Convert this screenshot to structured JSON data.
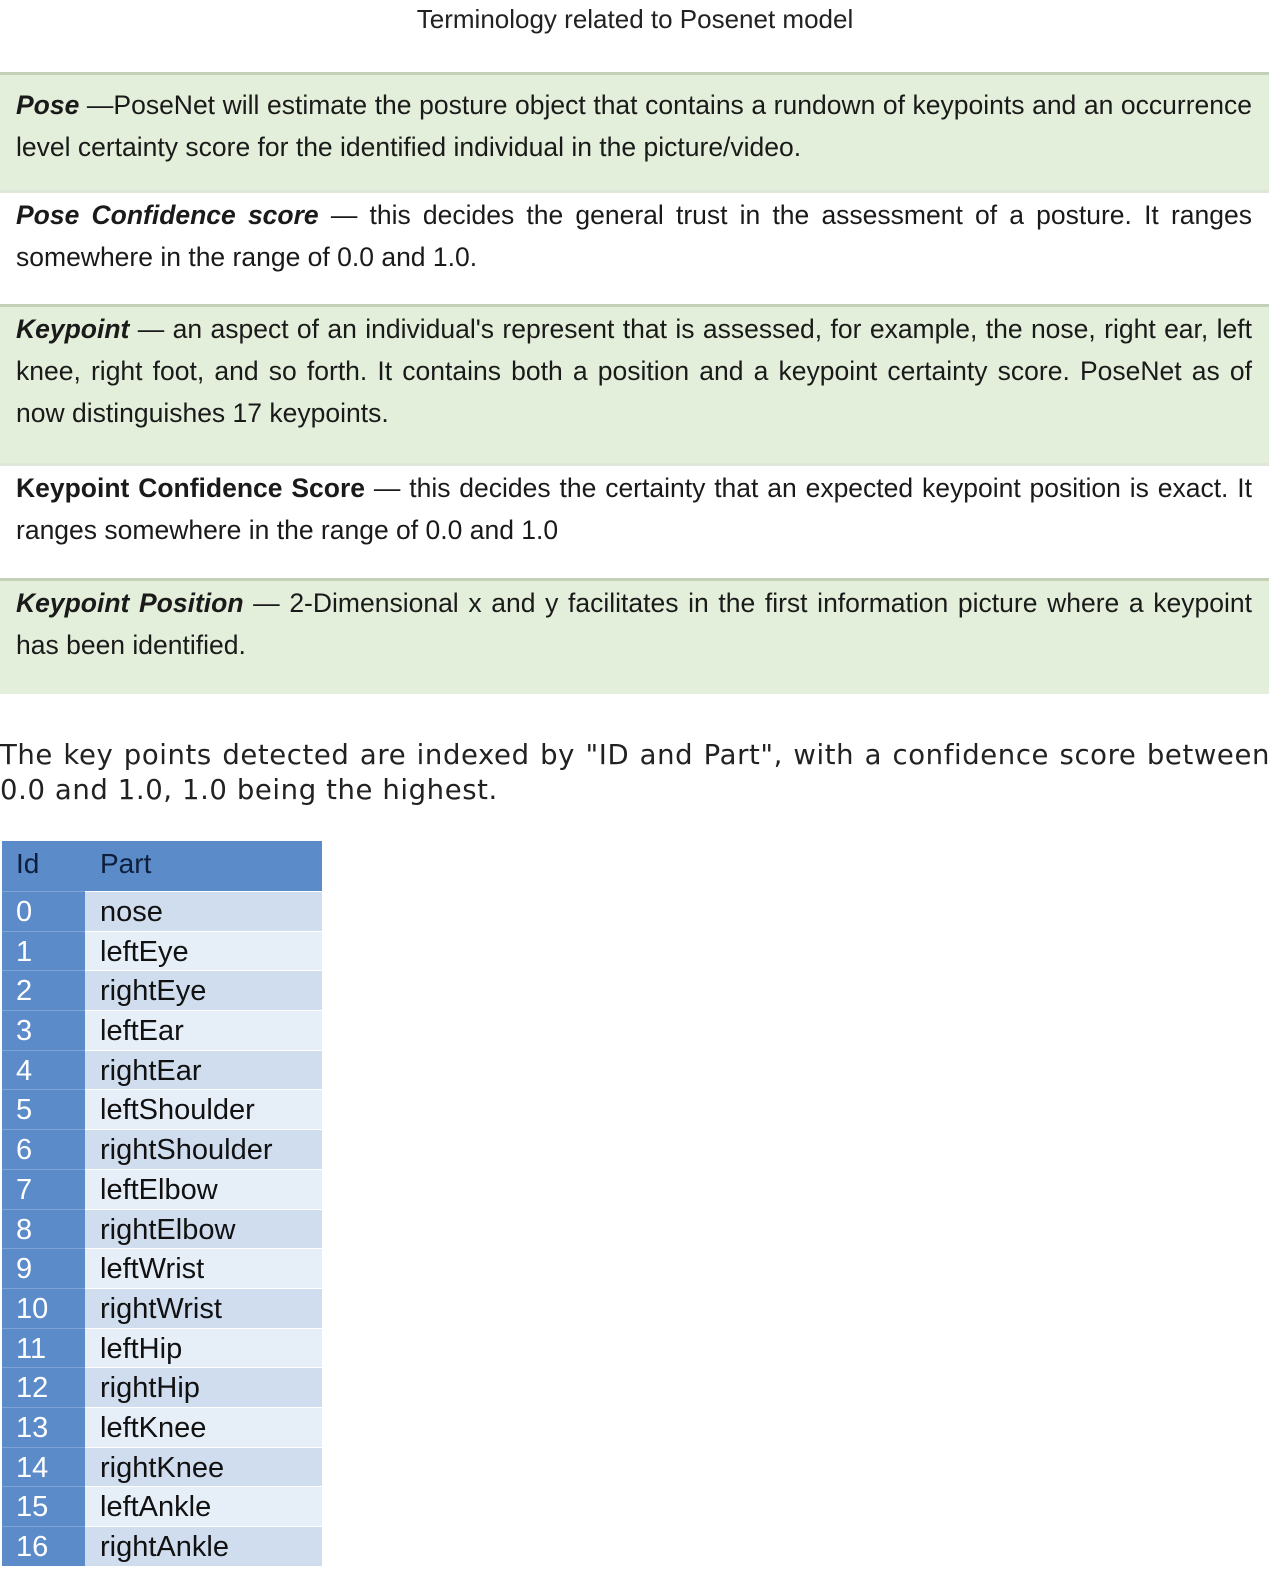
{
  "title": "Terminology related to Posenet model",
  "terms": [
    {
      "term": "Pose",
      "italic": true,
      "text": " —PoseNet will estimate the posture object that contains a rundown of keypoints and an occurrence level certainty score for the identified individual in the picture/video."
    },
    {
      "term": "Pose Confidence score",
      "italic": true,
      "text": " — this decides the general trust in the assessment of a posture. It ranges somewhere in the range of 0.0 and 1.0."
    },
    {
      "term": "Keypoint",
      "italic": true,
      "text": " — an aspect of an individual's represent that is assessed, for example, the nose, right ear, left knee, right foot, and so forth. It contains both a position and a keypoint certainty score. PoseNet as of now distinguishes 17 keypoints."
    },
    {
      "term": "Keypoint Confidence Score",
      "italic": false,
      "text": " — this decides the certainty that an expected keypoint position is exact. It ranges somewhere in the range of 0.0 and 1.0"
    },
    {
      "term": "Keypoint Position",
      "italic": true,
      "text": " — 2-Dimensional x and y facilitates in the first information picture where a keypoint has been identified."
    }
  ],
  "intro": "The key points detected are indexed by \"ID and Part\", with a confidence score between 0.0 and 1.0, 1.0 being the highest.",
  "table": {
    "headers": [
      "Id",
      "Part"
    ],
    "rows": [
      [
        "0",
        "nose"
      ],
      [
        "1",
        "leftEye"
      ],
      [
        "2",
        "rightEye"
      ],
      [
        "3",
        "leftEar"
      ],
      [
        "4",
        "rightEar"
      ],
      [
        "5",
        "leftShoulder"
      ],
      [
        "6",
        "rightShoulder"
      ],
      [
        "7",
        "leftElbow"
      ],
      [
        "8",
        "rightElbow"
      ],
      [
        "9",
        "leftWrist"
      ],
      [
        "10",
        "rightWrist"
      ],
      [
        "11",
        "leftHip"
      ],
      [
        "12",
        "rightHip"
      ],
      [
        "13",
        "leftKnee"
      ],
      [
        "14",
        "rightKnee"
      ],
      [
        "15",
        "leftAnkle"
      ],
      [
        "16",
        "rightAnkle"
      ]
    ]
  }
}
